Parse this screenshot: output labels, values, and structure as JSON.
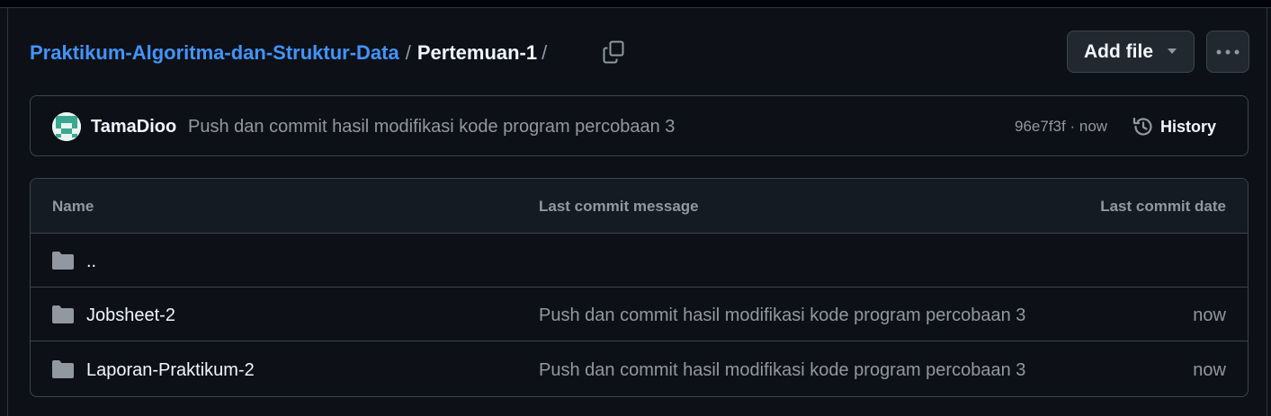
{
  "breadcrumb": {
    "repo": "Praktikum-Algoritma-dan-Struktur-Data",
    "separator": "/",
    "current": "Pertemuan-1",
    "trailing_separator": "/"
  },
  "header": {
    "add_file_label": "Add file"
  },
  "latest_commit": {
    "author": "TamaDioo",
    "message": "Push dan commit hasil modifikasi kode program percobaan 3",
    "sha": "96e7f3f",
    "separator": "·",
    "time": "now",
    "history_label": "History"
  },
  "table": {
    "columns": {
      "name": "Name",
      "message": "Last commit message",
      "date": "Last commit date"
    },
    "rows": [
      {
        "name": "..",
        "message": "",
        "date": "",
        "icon": "folder-icon"
      },
      {
        "name": "Jobsheet-2",
        "message": "Push dan commit hasil modifikasi kode program percobaan 3",
        "date": "now",
        "icon": "folder-icon"
      },
      {
        "name": "Laporan-Praktikum-2",
        "message": "Push dan commit hasil modifikasi kode program percobaan 3",
        "date": "now",
        "icon": "folder-icon"
      }
    ]
  },
  "colors": {
    "background": "#0d1117",
    "link": "#4493f8",
    "border": "#3d444d",
    "muted_text": "#9198a1",
    "primary_text": "#f0f6fc",
    "header_bg": "#151b23",
    "button_bg": "#212830"
  },
  "icons": [
    "copy-icon",
    "triangle-down-icon",
    "kebab-horizontal-icon",
    "avatar",
    "history-icon",
    "folder-icon"
  ]
}
